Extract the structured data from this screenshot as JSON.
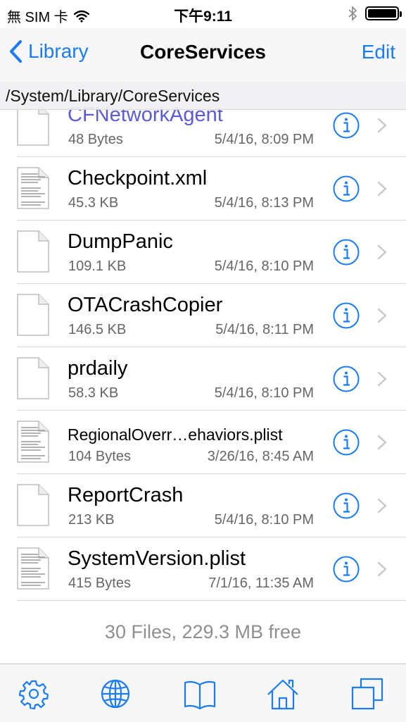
{
  "status_bar": {
    "carrier": "無 SIM 卡",
    "time": "下午9:11"
  },
  "nav": {
    "back_label": "Library",
    "title": "CoreServices",
    "edit_label": "Edit"
  },
  "path": "/System/Library/CoreServices",
  "files": [
    {
      "name": "CFNetworkAgent",
      "size": "48 Bytes",
      "date": "5/4/16, 8:09 PM",
      "icon": "blank-file-icon"
    },
    {
      "name": "Checkpoint.xml",
      "size": "45.3 KB",
      "date": "5/4/16, 8:13 PM",
      "icon": "text-file-icon"
    },
    {
      "name": "DumpPanic",
      "size": "109.1 KB",
      "date": "5/4/16, 8:10 PM",
      "icon": "blank-file-icon"
    },
    {
      "name": "OTACrashCopier",
      "size": "146.5 KB",
      "date": "5/4/16, 8:11 PM",
      "icon": "blank-file-icon"
    },
    {
      "name": "prdaily",
      "size": "58.3 KB",
      "date": "5/4/16, 8:10 PM",
      "icon": "blank-file-icon"
    },
    {
      "name": "RegionalOverr…ehaviors.plist",
      "size": "104 Bytes",
      "date": "3/26/16, 8:45 AM",
      "icon": "text-file-icon"
    },
    {
      "name": "ReportCrash",
      "size": "213 KB",
      "date": "5/4/16, 8:10 PM",
      "icon": "blank-file-icon"
    },
    {
      "name": "SystemVersion.plist",
      "size": "415 Bytes",
      "date": "7/1/16, 11:35 AM",
      "icon": "text-file-icon"
    }
  ],
  "footer": "30 Files, 229.3 MB free",
  "tabs": [
    "settings-icon",
    "globe-icon",
    "book-icon",
    "home-icon",
    "windows-icon"
  ],
  "colors": {
    "accent": "#1a7cf5",
    "secondary_text": "#666666",
    "footer_text": "#8e8e93"
  }
}
